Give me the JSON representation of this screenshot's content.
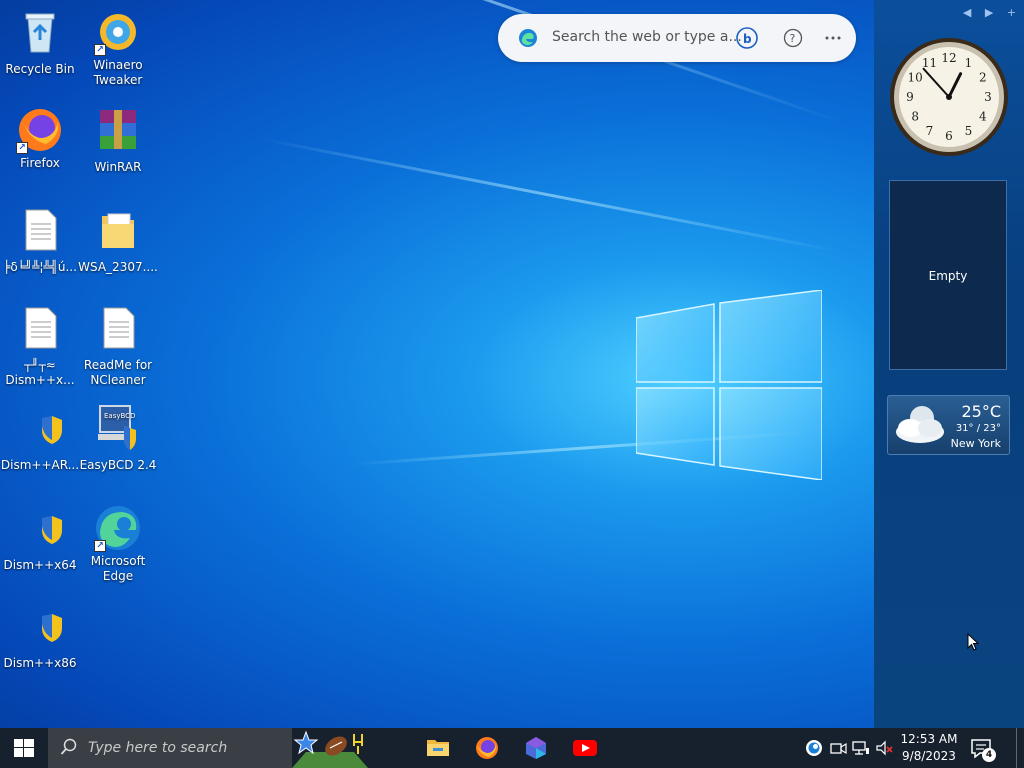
{
  "desktop": {
    "icons": [
      {
        "label": "Recycle Bin",
        "icon": "recycle-bin-icon"
      },
      {
        "label": "Winaero Tweaker",
        "icon": "winaero-tweaker-icon"
      },
      {
        "label": "Firefox",
        "icon": "firefox-icon"
      },
      {
        "label": "WinRAR",
        "icon": "winrar-icon"
      },
      {
        "label": "╞δ╘╝╩¦╩╣ú...",
        "icon": "text-file-icon"
      },
      {
        "label": "WSA_2307....",
        "icon": "folder-icon"
      },
      {
        "label": "┬╜┬≈ Dism++x...",
        "icon": "text-file-icon"
      },
      {
        "label": "ReadMe for NCleaner",
        "icon": "text-file-icon"
      },
      {
        "label": "Dism++AR...",
        "icon": "uac-shield-icon"
      },
      {
        "label": "EasyBCD 2.4",
        "icon": "easybcd-icon"
      },
      {
        "label": "Dism++x64",
        "icon": "uac-shield-icon"
      },
      {
        "label": "Microsoft Edge",
        "icon": "edge-icon"
      },
      {
        "label": "Dism++x86",
        "icon": "uac-shield-icon"
      }
    ]
  },
  "search_widget": {
    "placeholder": "Search the web or type a...",
    "bing_icon": "bing-icon",
    "help_icon": "question-icon",
    "more_icon": "more-icon"
  },
  "sidebar": {
    "controls": [
      "◀",
      "▶",
      "+"
    ],
    "clock": {
      "hour": 12,
      "minute": 53,
      "numerals": [
        "12",
        "1",
        "2",
        "3",
        "4",
        "5",
        "6",
        "7",
        "8",
        "9",
        "10",
        "11"
      ]
    },
    "empty_gadget": {
      "label": "Empty"
    },
    "weather": {
      "temp": "25°C",
      "range": "31° / 23°",
      "city": "New York"
    }
  },
  "taskbar": {
    "search_placeholder": "Type here to search",
    "apps": [
      {
        "name": "File Explorer",
        "icon": "folder-icon"
      },
      {
        "name": "Firefox",
        "icon": "firefox-icon"
      },
      {
        "name": "Copilot",
        "icon": "copilot-icon"
      },
      {
        "name": "YouTube",
        "icon": "youtube-icon"
      }
    ],
    "time": "12:53 AM",
    "date": "9/8/2023",
    "notifications": "4"
  },
  "colors": {
    "taskbar": "#17202d",
    "sidebar": "#083f7e",
    "accent": "#0a6fd8"
  }
}
